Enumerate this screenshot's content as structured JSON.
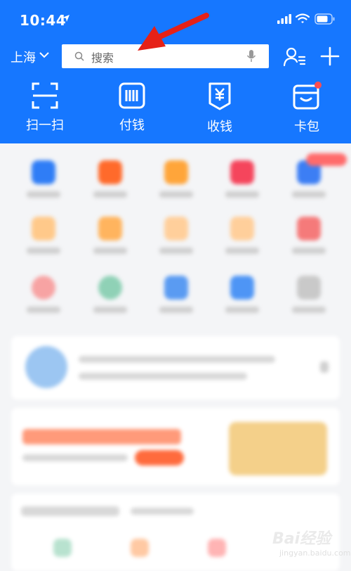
{
  "status_bar": {
    "time": "10:44"
  },
  "header": {
    "city": "上海",
    "search_placeholder": "搜索"
  },
  "quick_actions": [
    {
      "label": "扫一扫",
      "icon": "scan-icon"
    },
    {
      "label": "付钱",
      "icon": "pay-icon"
    },
    {
      "label": "收钱",
      "icon": "collect-icon"
    },
    {
      "label": "卡包",
      "icon": "card-wallet-icon"
    }
  ],
  "colors": {
    "brand": "#1677ff",
    "annotation_arrow": "#e62117",
    "badge": "#ff4d4f"
  },
  "watermark": {
    "text": "Bai经验",
    "sub": "jingyan.baidu.com"
  }
}
